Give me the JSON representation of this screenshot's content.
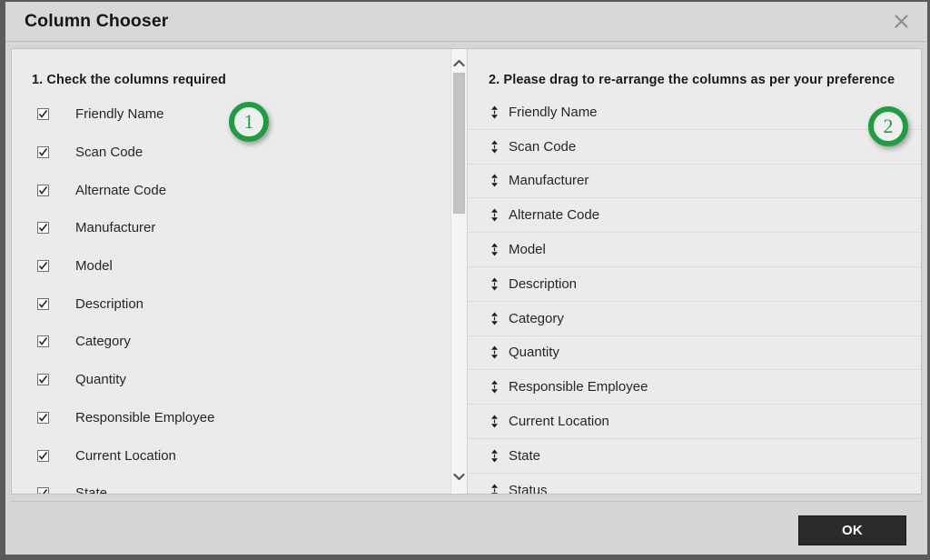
{
  "dialog": {
    "title": "Column Chooser",
    "close_icon": "close-x-icon"
  },
  "left_panel": {
    "heading": "1. Check the columns required",
    "badge": "1",
    "items": [
      {
        "label": "Friendly Name",
        "checked": true
      },
      {
        "label": "Scan Code",
        "checked": true
      },
      {
        "label": "Alternate Code",
        "checked": true
      },
      {
        "label": "Manufacturer",
        "checked": true
      },
      {
        "label": "Model",
        "checked": true
      },
      {
        "label": "Description",
        "checked": true
      },
      {
        "label": "Category",
        "checked": true
      },
      {
        "label": "Quantity",
        "checked": true
      },
      {
        "label": "Responsible Employee",
        "checked": true
      },
      {
        "label": "Current Location",
        "checked": true
      },
      {
        "label": "State",
        "checked": true
      }
    ],
    "scrollbar": {
      "up_icon": "chevron-up-icon",
      "down_icon": "chevron-down-icon"
    }
  },
  "right_panel": {
    "heading": "2. Please drag to re-arrange the columns as per your preference",
    "badge": "2",
    "items": [
      {
        "label": "Friendly Name",
        "handle_icon": "drag-updown-icon"
      },
      {
        "label": "Scan Code",
        "handle_icon": "drag-updown-icon"
      },
      {
        "label": "Manufacturer",
        "handle_icon": "drag-updown-icon"
      },
      {
        "label": "Alternate Code",
        "handle_icon": "drag-updown-icon"
      },
      {
        "label": "Model",
        "handle_icon": "drag-updown-icon"
      },
      {
        "label": "Description",
        "handle_icon": "drag-updown-icon"
      },
      {
        "label": "Category",
        "handle_icon": "drag-updown-icon"
      },
      {
        "label": "Quantity",
        "handle_icon": "drag-updown-icon"
      },
      {
        "label": "Responsible Employee",
        "handle_icon": "drag-updown-icon"
      },
      {
        "label": "Current Location",
        "handle_icon": "drag-updown-icon"
      },
      {
        "label": "State",
        "handle_icon": "drag-updown-icon"
      },
      {
        "label": "Status",
        "handle_icon": "drag-updown-icon"
      }
    ]
  },
  "footer": {
    "ok_label": "OK"
  },
  "colors": {
    "badge_green": "#1f9e41",
    "ok_button_bg": "#2b2b2b",
    "panel_bg": "#ebebeb",
    "chrome_bg": "#d6d6d6"
  }
}
